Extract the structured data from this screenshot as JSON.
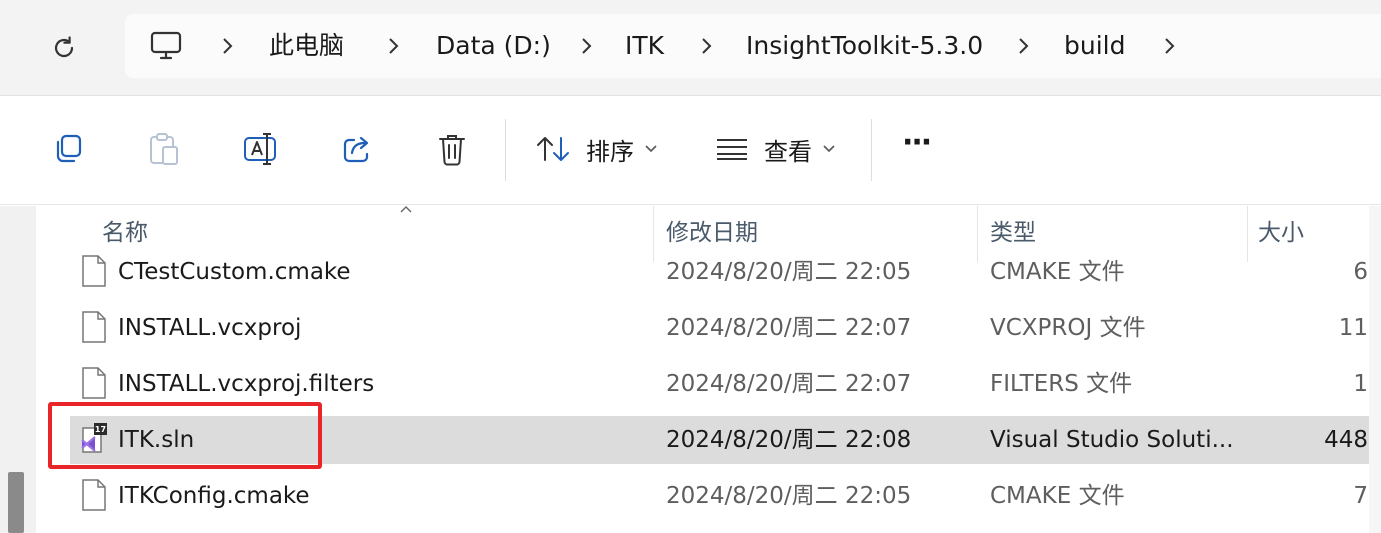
{
  "address_bar": {
    "refresh_icon": "refresh-icon",
    "computer_icon": "computer-icon",
    "crumbs": [
      "此电脑",
      "Data (D:)",
      "ITK",
      "InsightToolkit-5.3.0",
      "build"
    ]
  },
  "toolbar": {
    "copy_icon": "copy-icon",
    "paste_icon": "paste-icon",
    "rename_icon": "rename-icon",
    "share_icon": "share-icon",
    "delete_icon": "delete-icon",
    "sort_label": "排序",
    "view_label": "查看",
    "more_label": "···"
  },
  "columns": {
    "name": "名称",
    "modified": "修改日期",
    "type": "类型",
    "size": "大小"
  },
  "files": [
    {
      "name": "CTestCustom.cmake",
      "modified": "2024/8/20/周二 22:05",
      "type": "CMAKE 文件",
      "size": "6",
      "icon": "file-icon"
    },
    {
      "name": "INSTALL.vcxproj",
      "modified": "2024/8/20/周二 22:07",
      "type": "VCXPROJ 文件",
      "size": "11",
      "icon": "file-icon"
    },
    {
      "name": "INSTALL.vcxproj.filters",
      "modified": "2024/8/20/周二 22:07",
      "type": "FILTERS 文件",
      "size": "1",
      "icon": "file-icon"
    },
    {
      "name": "ITK.sln",
      "modified": "2024/8/20/周二 22:08",
      "type": "Visual Studio Soluti...",
      "size": "448",
      "icon": "visual-studio-solution-icon",
      "badge": "17"
    },
    {
      "name": "ITKConfig.cmake",
      "modified": "2024/8/20/周二 22:05",
      "type": "CMAKE 文件",
      "size": "7",
      "icon": "file-icon"
    }
  ],
  "colors": {
    "highlight_box": "#e8262a",
    "selected_row": "#dcdcdc",
    "visual_studio_purple": "#7b4fd1"
  }
}
